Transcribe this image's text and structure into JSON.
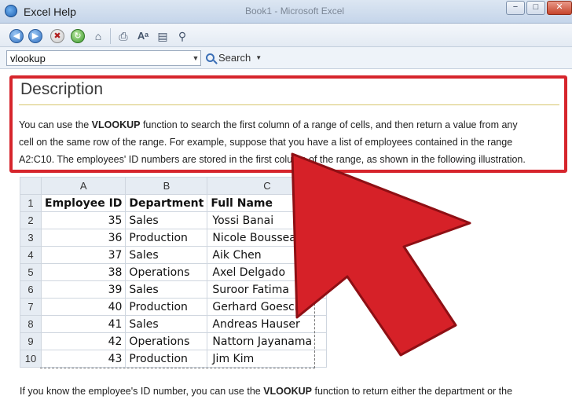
{
  "window": {
    "title": "Excel Help",
    "background_title": "Book1 - Microsoft Excel",
    "controls": {
      "minimize": "−",
      "maximize": "□",
      "close": "✕"
    }
  },
  "toolbar": {
    "buttons": [
      "back",
      "forward",
      "stop",
      "refresh",
      "home",
      "print",
      "text-size",
      "table-of-contents",
      "keep-on-top"
    ]
  },
  "search": {
    "value": "vlookup",
    "button_label": "Search"
  },
  "description": {
    "heading": "Description",
    "line1_a": "You can use the ",
    "line1_bold": "VLOOKUP",
    "line1_b": " function to search the first column of a range of cells, and then return a value from any",
    "line2": "cell on the same row of the range. For example, suppose that you have a list of employees contained in the range",
    "line3": "A2:C10. The employees' ID numbers are stored in the first column of the range, as shown in the following illustration."
  },
  "sheet": {
    "columns": [
      "A",
      "B",
      "C"
    ],
    "row_numbers": [
      "1",
      "2",
      "3",
      "4",
      "5",
      "6",
      "7",
      "8",
      "9",
      "10"
    ],
    "header": [
      "Employee ID",
      "Department",
      "Full Name"
    ],
    "rows": [
      [
        "35",
        "Sales",
        "Yossi Banai"
      ],
      [
        "36",
        "Production",
        "Nicole Bousseau"
      ],
      [
        "37",
        "Sales",
        "Aik Chen"
      ],
      [
        "38",
        "Operations",
        "Axel Delgado"
      ],
      [
        "39",
        "Sales",
        "Suroor Fatima"
      ],
      [
        "40",
        "Production",
        "Gerhard Goeschl"
      ],
      [
        "41",
        "Sales",
        "Andreas Hauser"
      ],
      [
        "42",
        "Operations",
        "Nattorn Jayanama"
      ],
      [
        "43",
        "Production",
        "Jim Kim"
      ]
    ]
  },
  "footer": {
    "text_a": "If you know the employee's ID number, you can use the ",
    "text_bold": "VLOOKUP",
    "text_b": " function to return either the department or the"
  },
  "colors": {
    "highlight_border": "#d6252c",
    "arrow_fill": "#d62128"
  }
}
